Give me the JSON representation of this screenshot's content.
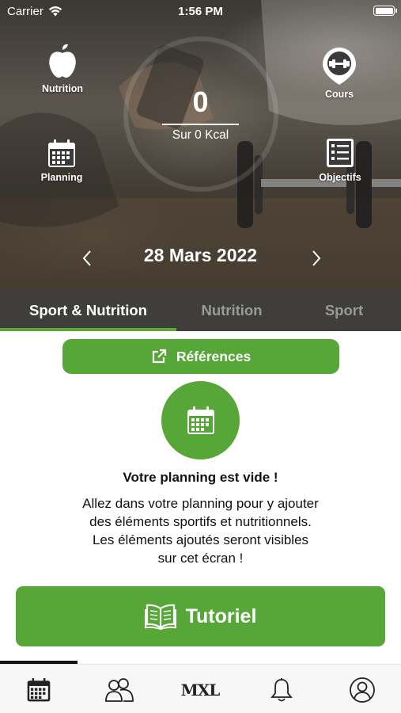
{
  "status_bar": {
    "carrier": "Carrier",
    "time": "1:56 PM"
  },
  "shortcuts": {
    "nutrition": {
      "label": "Nutrition",
      "icon": "apple-icon"
    },
    "courses": {
      "label": "Cours",
      "icon": "dumbbell-pin-icon"
    },
    "planning": {
      "label": "Planning",
      "icon": "calendar-icon"
    },
    "objectives": {
      "label": "Objectifs",
      "icon": "checklist-icon"
    }
  },
  "calories": {
    "value": "0",
    "subtitle": "Sur 0 Kcal"
  },
  "date": {
    "label": "28 Mars 2022"
  },
  "tabs": [
    {
      "label": "Sport & Nutrition",
      "active": true
    },
    {
      "label": "Nutrition",
      "active": false
    },
    {
      "label": "Sport",
      "active": false
    }
  ],
  "references_button": {
    "label": "Références",
    "icon": "external-link-icon"
  },
  "empty_state": {
    "icon": "calendar-icon",
    "title": "Votre planning est vide !",
    "description": "Allez dans votre planning pour y ajouter\ndes éléments sportifs et nutritionnels.\nLes éléments ajoutés seront visibles\nsur cet écran !"
  },
  "tutorial_button": {
    "label": "Tutoriel",
    "icon": "open-book-icon"
  },
  "bottom_nav": {
    "items": [
      {
        "name": "calendar-icon"
      },
      {
        "name": "community-icon"
      },
      {
        "name": "mxl-logo",
        "logo_text": "MXL"
      },
      {
        "name": "bell-icon"
      },
      {
        "name": "profile-icon"
      }
    ]
  },
  "colors": {
    "accent": "#56a737",
    "tab_bar": "#3f3e3a",
    "tab_inactive": "#9a9a96"
  }
}
